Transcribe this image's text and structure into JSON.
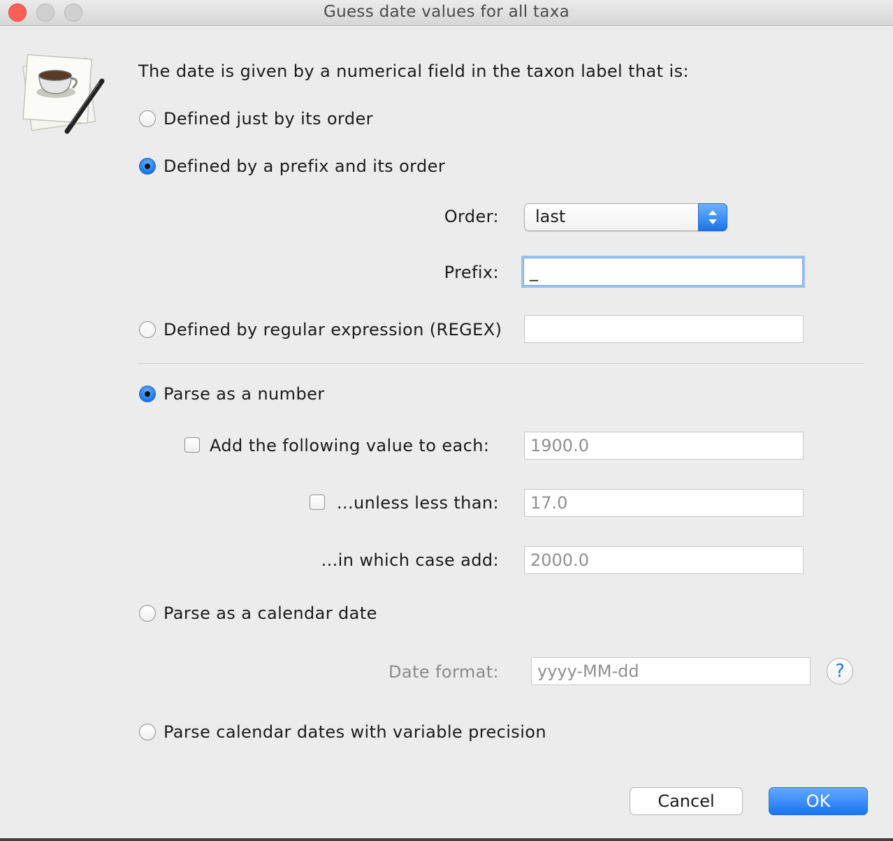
{
  "window": {
    "title": "Guess date values for all taxa"
  },
  "intro": "The date is given by a numerical field in the taxon label that is:",
  "options": {
    "defined_by_order": {
      "label": "Defined just by its order",
      "selected": false
    },
    "defined_by_prefix": {
      "label": "Defined by a prefix and its order",
      "selected": true
    },
    "defined_by_regex": {
      "label": "Defined by regular expression (REGEX)",
      "selected": false,
      "value": ""
    }
  },
  "order": {
    "label": "Order:",
    "value": "last"
  },
  "prefix": {
    "label": "Prefix:",
    "value": "_"
  },
  "parse": {
    "number": {
      "label": "Parse as a number",
      "selected": true
    },
    "add_value": {
      "label": "Add the following value to each:",
      "checked": false,
      "value": "1900.0"
    },
    "unless_less_than": {
      "label": "...unless less than:",
      "checked": false,
      "value": "17.0"
    },
    "in_which_case_add": {
      "label": "...in which case add:",
      "value": "2000.0"
    },
    "calendar": {
      "label": "Parse as a calendar date",
      "selected": false
    },
    "date_format": {
      "label": "Date format:",
      "placeholder": "yyyy-MM-dd"
    },
    "variable_precision": {
      "label": "Parse calendar dates with variable precision",
      "selected": false
    }
  },
  "help": {
    "label": "?"
  },
  "buttons": {
    "cancel": "Cancel",
    "ok": "OK"
  },
  "icons": {
    "app": "coffee-cup-pen-icon",
    "help": "question-mark-icon",
    "select": "updown-arrows-icon"
  },
  "colors": {
    "accent": "#1a74f5",
    "close": "#fc5f57",
    "background": "#ececec"
  }
}
